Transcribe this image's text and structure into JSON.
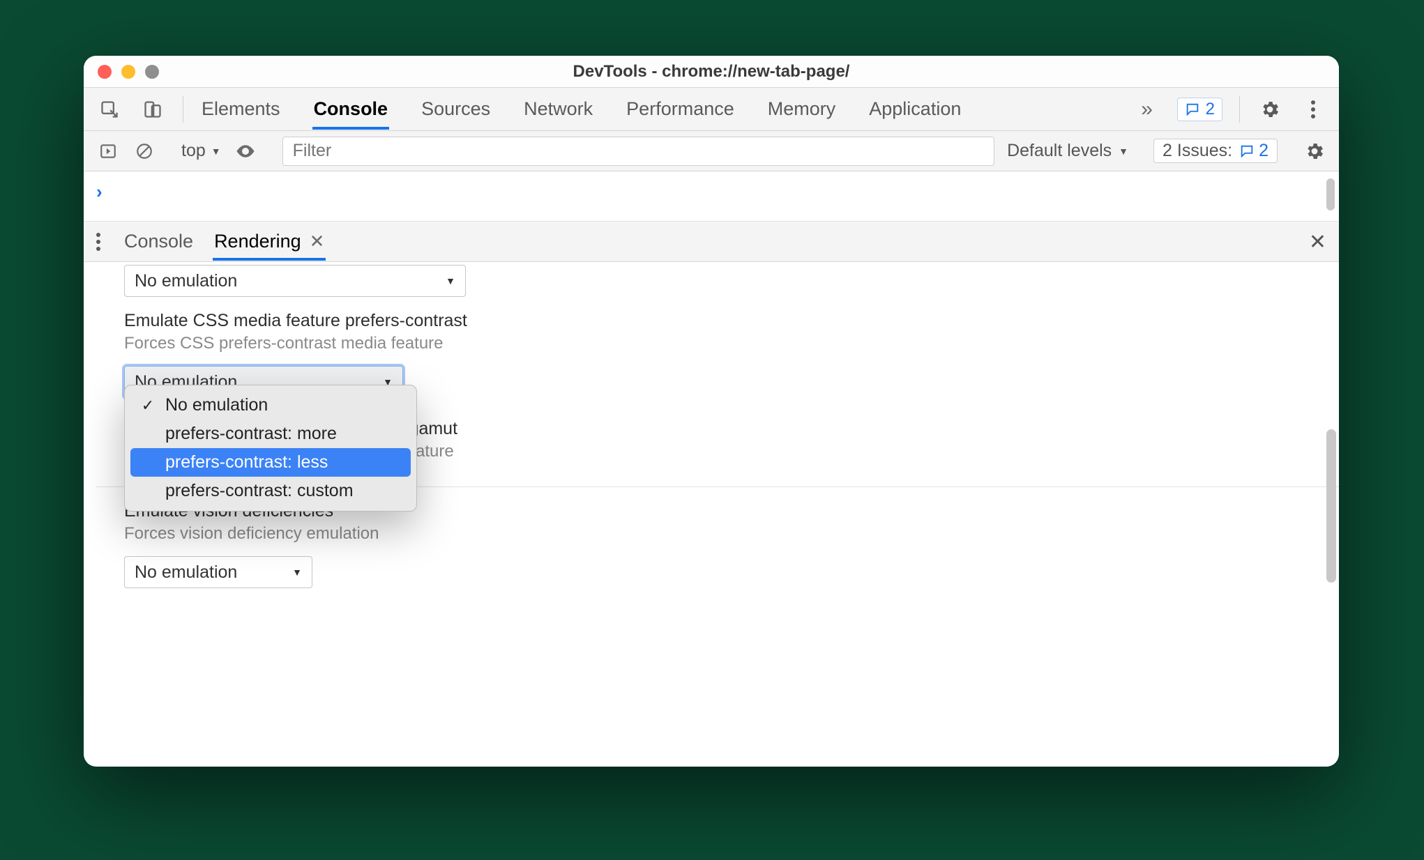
{
  "title": "DevTools - chrome://new-tab-page/",
  "main_tabs": [
    "Elements",
    "Console",
    "Sources",
    "Network",
    "Performance",
    "Memory",
    "Application"
  ],
  "active_main_tab": "Console",
  "feedback_count": "2",
  "console_toolbar": {
    "context": "top",
    "filter_placeholder": "Filter",
    "levels": "Default levels",
    "issues_label": "2 Issues:",
    "issues_count": "2"
  },
  "drawer": {
    "tabs": [
      "Console",
      "Rendering"
    ],
    "active": "Rendering"
  },
  "rendering": {
    "top_select_value": "No emulation",
    "prefers_contrast": {
      "title": "Emulate CSS media feature prefers-contrast",
      "subtitle": "Forces CSS prefers-contrast media feature",
      "selected": "No emulation",
      "options": [
        "No emulation",
        "prefers-contrast: more",
        "prefers-contrast: less",
        "prefers-contrast: custom"
      ],
      "highlighted": "prefers-contrast: less",
      "checked": "No emulation"
    },
    "color_gamut": {
      "title_visible_tail": "or-gamut",
      "subtitle_visible_tail": "a feature"
    },
    "vision": {
      "title": "Emulate vision deficiencies",
      "subtitle": "Forces vision deficiency emulation",
      "selected": "No emulation"
    }
  }
}
